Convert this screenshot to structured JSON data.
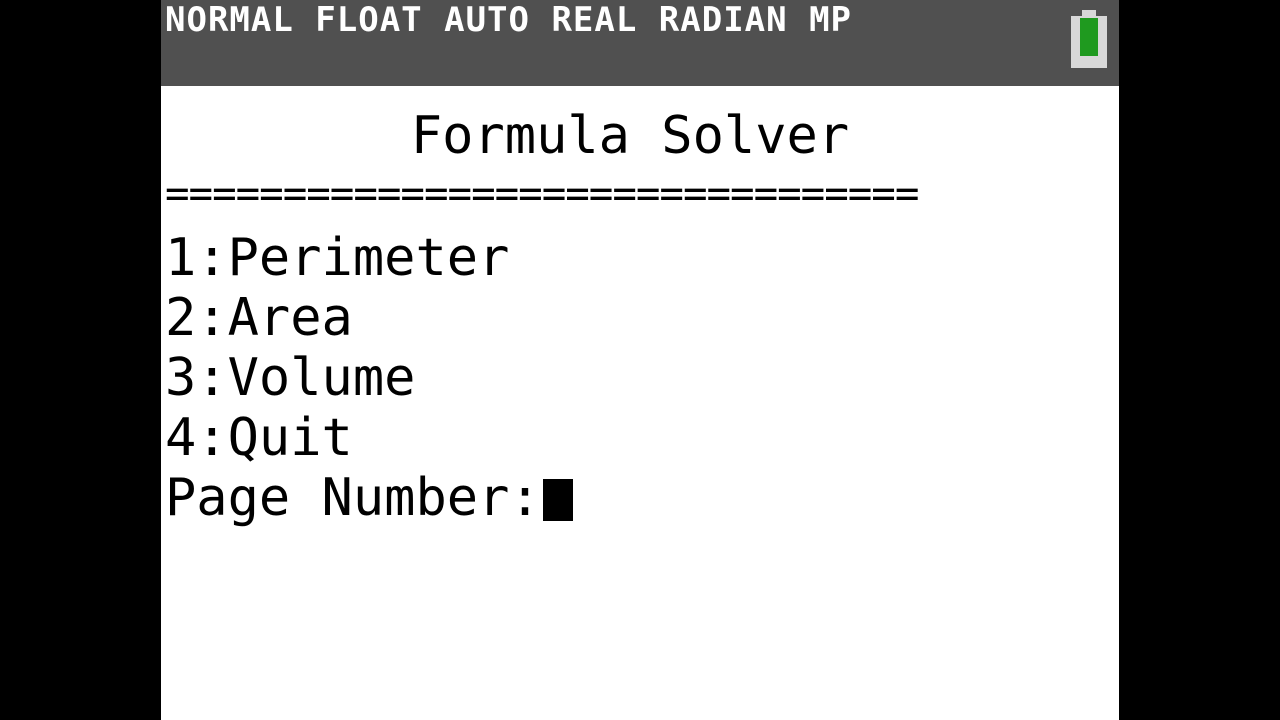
{
  "status_bar": {
    "modes": "NORMAL FLOAT AUTO REAL RADIAN MP",
    "battery_icon": "battery-icon",
    "battery_color": "#1f9a1f"
  },
  "screen": {
    "title": "Formula Solver",
    "separator": "================================",
    "menu_items": [
      "1:Perimeter",
      "2:Area",
      "3:Volume",
      "4:Quit"
    ],
    "prompt": "Page Number:"
  }
}
